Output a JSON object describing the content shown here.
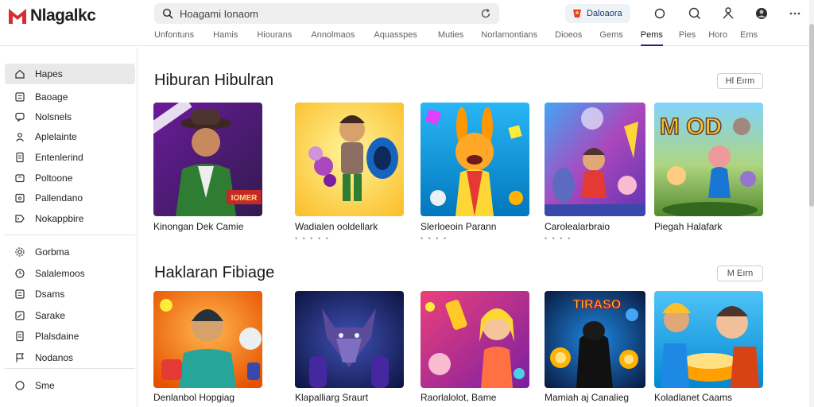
{
  "app": {
    "brand": "Nlagalkc",
    "brand_color": "#d32f2f"
  },
  "search": {
    "placeholder": "Hoagami Ionaom",
    "value": ""
  },
  "account": {
    "label": "Daloaora"
  },
  "header_icons": [
    "circle-icon",
    "search-icon",
    "person-icon",
    "avatar-icon",
    "more-icon"
  ],
  "tabs": [
    {
      "label": "Unfontuns",
      "active": false
    },
    {
      "label": "Hamis",
      "active": false
    },
    {
      "label": "Hiourans",
      "active": false
    },
    {
      "label": "Annolmaos",
      "active": false
    },
    {
      "label": "Aquasspes",
      "active": false
    },
    {
      "label": "Muties",
      "active": false
    },
    {
      "label": "Norlamontians",
      "active": false
    },
    {
      "label": "Dioeos",
      "active": false
    },
    {
      "label": "Gems",
      "active": false
    },
    {
      "label": "Pems",
      "active": true
    },
    {
      "label": "Pies",
      "active": false
    },
    {
      "label": "Horo",
      "active": false
    },
    {
      "label": "Ems",
      "active": false
    }
  ],
  "sidebar": {
    "items": [
      {
        "label": "Hapes",
        "icon": "home-icon",
        "active": true
      },
      {
        "label": "Baoage",
        "icon": "list-icon",
        "active": false
      },
      {
        "label": "Nolsnels",
        "icon": "chat-icon",
        "active": false
      },
      {
        "label": "Aplelainte",
        "icon": "person-icon",
        "active": false
      },
      {
        "label": "Entenlerind",
        "icon": "document-icon",
        "active": false
      },
      {
        "label": "Poltoone",
        "icon": "folder-icon",
        "active": false
      },
      {
        "label": "Pallendano",
        "icon": "calendar-icon",
        "active": false
      },
      {
        "label": "Nokappbire",
        "icon": "tag-icon",
        "active": false
      },
      {
        "label": "Gorbma",
        "icon": "settings-icon",
        "active": false
      },
      {
        "label": "Salalemoos",
        "icon": "clock-icon",
        "active": false
      },
      {
        "label": "Dsams",
        "icon": "list-icon",
        "active": false
      },
      {
        "label": "Sarake",
        "icon": "edit-icon",
        "active": false
      },
      {
        "label": "Plalsdaine",
        "icon": "document-icon",
        "active": false
      },
      {
        "label": "Nodanos",
        "icon": "flag-icon",
        "active": false
      },
      {
        "label": "Sme",
        "icon": "circle-icon",
        "active": false
      }
    ]
  },
  "sections": [
    {
      "title": "Hiburan Hibulran",
      "see_all": "Hl Eırm",
      "cards": [
        {
          "title": "Kinongan Dek Camie",
          "sub": "",
          "badge": "IOMER"
        },
        {
          "title": "Wadialen ooldellark",
          "sub": "• • • • •",
          "badge": ""
        },
        {
          "title": "Slerloeoin Parann",
          "sub": "• • • •",
          "badge": ""
        },
        {
          "title": "Carolealarbraio",
          "sub": "• • • •",
          "badge": ""
        },
        {
          "title": "Piegah Halafark",
          "sub": "",
          "badge": "M OD"
        }
      ]
    },
    {
      "title": "Haklaran Fibiage",
      "see_all": "M Eırn",
      "cards": [
        {
          "title": "Denlanbol Hopgiag",
          "sub": "",
          "badge": ""
        },
        {
          "title": "Klapalliarg Sraurt",
          "sub": "",
          "badge": ""
        },
        {
          "title": "Raorlalolot, Bame",
          "sub": "",
          "badge": ""
        },
        {
          "title": "Mamiah aj Canalieg",
          "sub": "",
          "badge": "TIRASO"
        },
        {
          "title": "Koladlanet Caams",
          "sub": "",
          "badge": ""
        }
      ]
    }
  ]
}
